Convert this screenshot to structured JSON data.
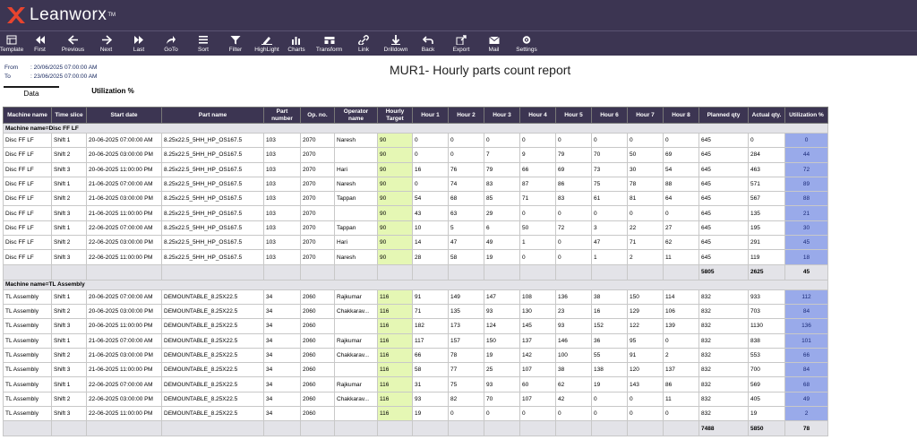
{
  "brand": {
    "name": "Leanworx",
    "tm": "TM"
  },
  "toolbar": [
    {
      "label": "Template",
      "icon": "template-icon"
    },
    {
      "label": "First",
      "icon": "first-icon"
    },
    {
      "label": "Previous",
      "icon": "previous-icon"
    },
    {
      "label": "Next",
      "icon": "next-icon"
    },
    {
      "label": "Last",
      "icon": "last-icon"
    },
    {
      "label": "GoTo",
      "icon": "goto-icon"
    },
    {
      "label": "Sort",
      "icon": "sort-icon"
    },
    {
      "label": "Filter",
      "icon": "filter-icon"
    },
    {
      "label": "HighLight",
      "icon": "highlight-icon"
    },
    {
      "label": "Charts",
      "icon": "charts-icon"
    },
    {
      "label": "Transform",
      "icon": "transform-icon"
    },
    {
      "label": "Link",
      "icon": "link-icon"
    },
    {
      "label": "Drilldown",
      "icon": "drilldown-icon"
    },
    {
      "label": "Back",
      "icon": "back-icon"
    },
    {
      "label": "Export",
      "icon": "export-icon"
    },
    {
      "label": "Mail",
      "icon": "mail-icon"
    },
    {
      "label": "Settings",
      "icon": "settings-icon"
    }
  ],
  "report": {
    "from_label": "From",
    "from_value": ": 20/06/2025 07:00:00 AM",
    "to_label": "To",
    "to_value": ": 23/06/2025 07:00:00 AM",
    "title": "MUR1- Hourly parts count report"
  },
  "tabs": [
    {
      "label": "Data",
      "active": true
    },
    {
      "label": "Utilization %",
      "active": false
    }
  ],
  "table": {
    "columns": [
      "Machine name",
      "Time slice",
      "Start date",
      "Part name",
      "Part number",
      "Op. no.",
      "Operator name",
      "Hourly Target",
      "Hour 1",
      "Hour 2",
      "Hour 3",
      "Hour 4",
      "Hour 5",
      "Hour 6",
      "Hour 7",
      "Hour 8",
      "Planned qty",
      "Actual qty.",
      "Utilization %"
    ],
    "groups": [
      {
        "label": "Machine name=Disc FF LF",
        "rows": [
          [
            "Disc FF LF",
            "Shift 1",
            "20-06-2025 07:00:00 AM",
            "8.25x22.5_5HH_HP_OS167.5",
            "103",
            "2070",
            "Naresh",
            "90",
            "0",
            "0",
            "0",
            "0",
            "0",
            "0",
            "0",
            "0",
            "645",
            "0",
            "0"
          ],
          [
            "Disc FF LF",
            "Shift 2",
            "20-06-2025 03:00:00 PM",
            "8.25x22.5_5HH_HP_OS167.5",
            "103",
            "2070",
            "",
            "90",
            "0",
            "0",
            "7",
            "9",
            "79",
            "70",
            "50",
            "69",
            "645",
            "284",
            "44"
          ],
          [
            "Disc FF LF",
            "Shift 3",
            "20-06-2025 11:00:00 PM",
            "8.25x22.5_5HH_HP_OS167.5",
            "103",
            "2070",
            "Hari",
            "90",
            "16",
            "76",
            "79",
            "66",
            "69",
            "73",
            "30",
            "54",
            "645",
            "463",
            "72"
          ],
          [
            "Disc FF LF",
            "Shift 1",
            "21-06-2025 07:00:00 AM",
            "8.25x22.5_5HH_HP_OS167.5",
            "103",
            "2070",
            "Naresh",
            "90",
            "0",
            "74",
            "83",
            "87",
            "86",
            "75",
            "78",
            "88",
            "645",
            "571",
            "89"
          ],
          [
            "Disc FF LF",
            "Shift 2",
            "21-06-2025 03:00:00 PM",
            "8.25x22.5_5HH_HP_OS167.5",
            "103",
            "2070",
            "Tappan",
            "90",
            "54",
            "68",
            "85",
            "71",
            "83",
            "61",
            "81",
            "64",
            "645",
            "567",
            "88"
          ],
          [
            "Disc FF LF",
            "Shift 3",
            "21-06-2025 11:00:00 PM",
            "8.25x22.5_5HH_HP_OS167.5",
            "103",
            "2070",
            "",
            "90",
            "43",
            "63",
            "29",
            "0",
            "0",
            "0",
            "0",
            "0",
            "645",
            "135",
            "21"
          ],
          [
            "Disc FF LF",
            "Shift 1",
            "22-06-2025 07:00:00 AM",
            "8.25x22.5_5HH_HP_OS167.5",
            "103",
            "2070",
            "Tappan",
            "90",
            "10",
            "5",
            "6",
            "50",
            "72",
            "3",
            "22",
            "27",
            "645",
            "195",
            "30"
          ],
          [
            "Disc FF LF",
            "Shift 2",
            "22-06-2025 03:00:00 PM",
            "8.25x22.5_5HH_HP_OS167.5",
            "103",
            "2070",
            "Hari",
            "90",
            "14",
            "47",
            "49",
            "1",
            "0",
            "47",
            "71",
            "62",
            "645",
            "291",
            "45"
          ],
          [
            "Disc FF LF",
            "Shift 3",
            "22-06-2025 11:00:00 PM",
            "8.25x22.5_5HH_HP_OS167.5",
            "103",
            "2070",
            "Naresh",
            "90",
            "28",
            "58",
            "19",
            "0",
            "0",
            "1",
            "2",
            "11",
            "645",
            "119",
            "18"
          ]
        ],
        "subtotal": {
          "planned": "5805",
          "actual": "2625",
          "util": "45"
        }
      },
      {
        "label": "Machine name=TL Assembly",
        "rows": [
          [
            "TL Assembly",
            "Shift 1",
            "20-06-2025 07:00:00 AM",
            "DEMOUNTABLE_8.25X22.5",
            "34",
            "2060",
            "Rajkumar",
            "116",
            "91",
            "149",
            "147",
            "108",
            "136",
            "38",
            "150",
            "114",
            "832",
            "933",
            "112"
          ],
          [
            "TL Assembly",
            "Shift 2",
            "20-06-2025 03:00:00 PM",
            "DEMOUNTABLE_8.25X22.5",
            "34",
            "2060",
            "Chakkarav...",
            "116",
            "71",
            "135",
            "93",
            "130",
            "23",
            "16",
            "129",
            "106",
            "832",
            "703",
            "84"
          ],
          [
            "TL Assembly",
            "Shift 3",
            "20-06-2025 11:00:00 PM",
            "DEMOUNTABLE_8.25X22.5",
            "34",
            "2060",
            "",
            "116",
            "182",
            "173",
            "124",
            "145",
            "93",
            "152",
            "122",
            "139",
            "832",
            "1130",
            "136"
          ],
          [
            "TL Assembly",
            "Shift 1",
            "21-06-2025 07:00:00 AM",
            "DEMOUNTABLE_8.25X22.5",
            "34",
            "2060",
            "Rajkumar",
            "116",
            "117",
            "157",
            "150",
            "137",
            "146",
            "36",
            "95",
            "0",
            "832",
            "838",
            "101"
          ],
          [
            "TL Assembly",
            "Shift 2",
            "21-06-2025 03:00:00 PM",
            "DEMOUNTABLE_8.25X22.5",
            "34",
            "2060",
            "Chakkarav...",
            "116",
            "66",
            "78",
            "19",
            "142",
            "100",
            "55",
            "91",
            "2",
            "832",
            "553",
            "66"
          ],
          [
            "TL Assembly",
            "Shift 3",
            "21-06-2025 11:00:00 PM",
            "DEMOUNTABLE_8.25X22.5",
            "34",
            "2060",
            "",
            "116",
            "58",
            "77",
            "25",
            "107",
            "38",
            "138",
            "120",
            "137",
            "832",
            "700",
            "84"
          ],
          [
            "TL Assembly",
            "Shift 1",
            "22-06-2025 07:00:00 AM",
            "DEMOUNTABLE_8.25X22.5",
            "34",
            "2060",
            "Rajkumar",
            "116",
            "31",
            "75",
            "93",
            "60",
            "62",
            "19",
            "143",
            "86",
            "832",
            "569",
            "68"
          ],
          [
            "TL Assembly",
            "Shift 2",
            "22-06-2025 03:00:00 PM",
            "DEMOUNTABLE_8.25X22.5",
            "34",
            "2060",
            "Chakkarav...",
            "116",
            "93",
            "82",
            "70",
            "107",
            "42",
            "0",
            "0",
            "11",
            "832",
            "405",
            "49"
          ],
          [
            "TL Assembly",
            "Shift 3",
            "22-06-2025 11:00:00 PM",
            "DEMOUNTABLE_8.25X22.5",
            "34",
            "2060",
            "",
            "116",
            "19",
            "0",
            "0",
            "0",
            "0",
            "0",
            "0",
            "0",
            "832",
            "19",
            "2"
          ]
        ],
        "subtotal": {
          "planned": "7488",
          "actual": "5850",
          "util": "78"
        }
      }
    ]
  },
  "colors": {
    "header_bg": "#3c3552",
    "target_bg": "#e5f7b4",
    "utilization_bg": "#99aaea",
    "group_bg": "#e3e3e8"
  }
}
